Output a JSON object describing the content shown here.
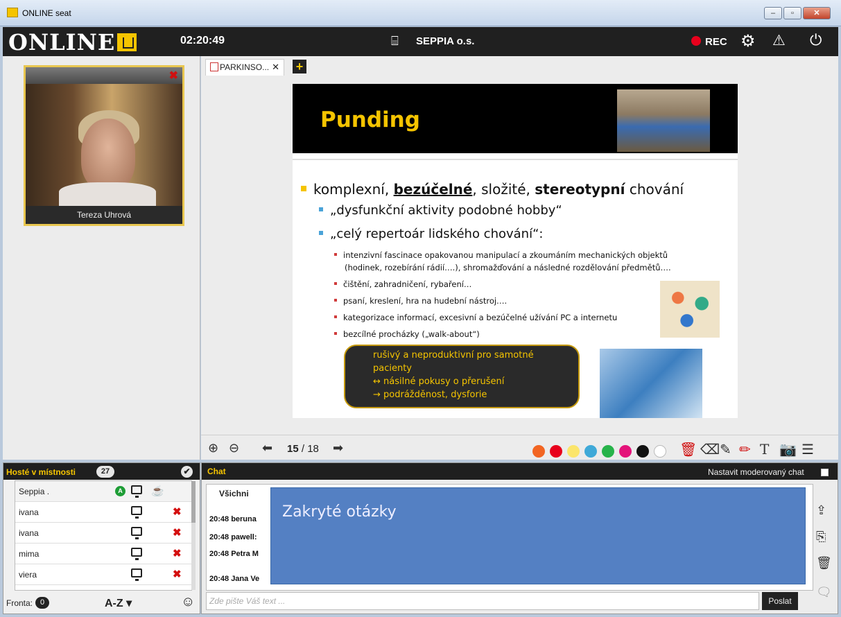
{
  "window": {
    "title": "ONLINE seat",
    "buttons": [
      "–",
      "▫",
      "✕"
    ]
  },
  "header": {
    "logo_a": "ONLINE",
    "clock": "02:20:49",
    "org": "SEPPIA o.s.",
    "rec": "REC"
  },
  "video": {
    "name": "Tereza Uhrová"
  },
  "tab": {
    "label": "PARKINSO...",
    "close": "✕",
    "add": "+"
  },
  "slide": {
    "title": "Punding",
    "bullet1_pre": "komplexní, ",
    "bullet1_u": "bezúčelné",
    "bullet1_mid": ", složité, ",
    "bullet1_b": "stereotypní",
    "bullet1_post": " chování",
    "sub1": "„dysfunkční aktivity podobné hobby“",
    "sub2": "„celý repertoár lidského chování“:",
    "items": [
      "intenzivní fascinace opakovanou manipulací a zkoumáním mechanických objektů",
      "(hodinek, rozebírání rádií….), shromažďování a následné rozdělování předmětů….",
      "čištění, zahradničení, rybaření…",
      "psaní, kreslení, hra na hudební nástroj….",
      "kategorizace informací, excesivní a bezúčelné užívání PC a internetu",
      "bezcílné procházky („walk-about“)"
    ],
    "callout": [
      "rušivý a neproduktivní pro samotné",
      "pacienty",
      "↔ násilné pokusy o přerušení",
      "→ podrážděnost, dysforie"
    ]
  },
  "nav": {
    "page": "15",
    "total": "/ 18"
  },
  "palette": [
    "#f26522",
    "#e8001c",
    "#fbe56b",
    "#3fa9d8",
    "#27b34a",
    "#e4137a",
    "#111111",
    "#ffffff"
  ],
  "guests": {
    "title": "Hosté v místnosti",
    "count": "27",
    "rows": [
      {
        "name": "Seppia .",
        "a": "A",
        "x": ""
      },
      {
        "name": "ivana",
        "a": "",
        "x": "✖"
      },
      {
        "name": "ivana",
        "a": "",
        "x": "✖"
      },
      {
        "name": "mima",
        "a": "",
        "x": "✖"
      },
      {
        "name": "viera",
        "a": "",
        "x": "✖"
      }
    ],
    "queue_label": "Fronta:",
    "queue_count": "0",
    "sort": "A-Z ▾"
  },
  "chat": {
    "title": "Chat",
    "moderated": "Nastavit moderovaný chat",
    "tab": "Všichni",
    "messages": [
      "20:48 beruna",
      "20:48 pawell:",
      "20:48 Petra M",
      "20:48 Jana Ve"
    ],
    "overlay": "Zakryté otázky",
    "placeholder": "Zde pište Váš text ...",
    "send": "Poslat"
  }
}
